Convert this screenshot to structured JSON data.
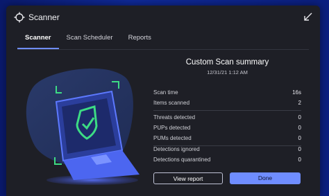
{
  "window": {
    "title": "Scanner"
  },
  "tabs": [
    {
      "label": "Scanner",
      "active": true
    },
    {
      "label": "Scan Scheduler",
      "active": false
    },
    {
      "label": "Reports",
      "active": false
    }
  ],
  "summary": {
    "title": "Custom Scan summary",
    "date": "12/31/21 1:12 AM",
    "rows": [
      {
        "label": "Scan time",
        "value": "16s"
      },
      {
        "label": "Items scanned",
        "value": "2"
      },
      {
        "label": "Threats detected",
        "value": "0"
      },
      {
        "label": "PUPs detected",
        "value": "0"
      },
      {
        "label": "PUMs detected",
        "value": "0"
      },
      {
        "label": "Detections ignored",
        "value": "0"
      },
      {
        "label": "Detections quarantined",
        "value": "0"
      }
    ]
  },
  "buttons": {
    "view_report": "View report",
    "done": "Done"
  },
  "colors": {
    "accent": "#6f8dff",
    "shield_green": "#3ddc84",
    "window_bg": "#1e1f26",
    "desktop_bg": "#0f2a9a"
  },
  "icons": {
    "app": "scanner-crosshair-icon",
    "collapse": "collapse-arrow-icon",
    "illustration_shield": "shield-check-icon"
  }
}
